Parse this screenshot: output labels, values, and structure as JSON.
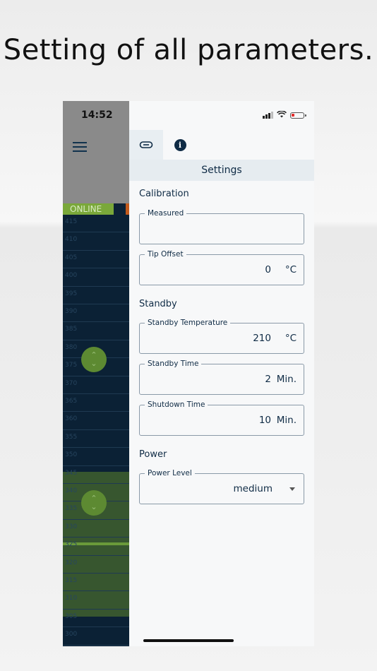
{
  "headline": "Setting of all parameters.",
  "status_bar": {
    "time": "14:52"
  },
  "background_app": {
    "status_badge": "ONLINE",
    "scale_ticks": [
      "415",
      "410",
      "405",
      "400",
      "395",
      "390",
      "385",
      "380",
      "375",
      "370",
      "365",
      "360",
      "355",
      "350",
      "345",
      "340",
      "335",
      "330",
      "325",
      "320",
      "315",
      "310",
      "305",
      "300"
    ],
    "knob_glyph": "⌃⌄"
  },
  "drawer": {
    "tabs": [
      {
        "icon": "link-icon"
      },
      {
        "icon": "info-icon",
        "glyph": "i"
      }
    ],
    "title": "Settings",
    "sections": {
      "calibration": "Calibration",
      "standby": "Standby",
      "power": "Power"
    },
    "fields": {
      "measured": {
        "label": "Measured",
        "value": ""
      },
      "tip_offset": {
        "label": "Tip Offset",
        "value": "0",
        "unit": "°C"
      },
      "standby_temperature": {
        "label": "Standby Temperature",
        "value": "210",
        "unit": "°C"
      },
      "standby_time": {
        "label": "Standby Time",
        "value": "2",
        "unit": "Min."
      },
      "shutdown_time": {
        "label": "Shutdown Time",
        "value": "10",
        "unit": "Min."
      },
      "power_level": {
        "label": "Power Level",
        "value": "medium"
      }
    }
  },
  "colors": {
    "accent": "#0f2b45",
    "online": "#7aa83a",
    "battery_low": "#e32b2b"
  }
}
